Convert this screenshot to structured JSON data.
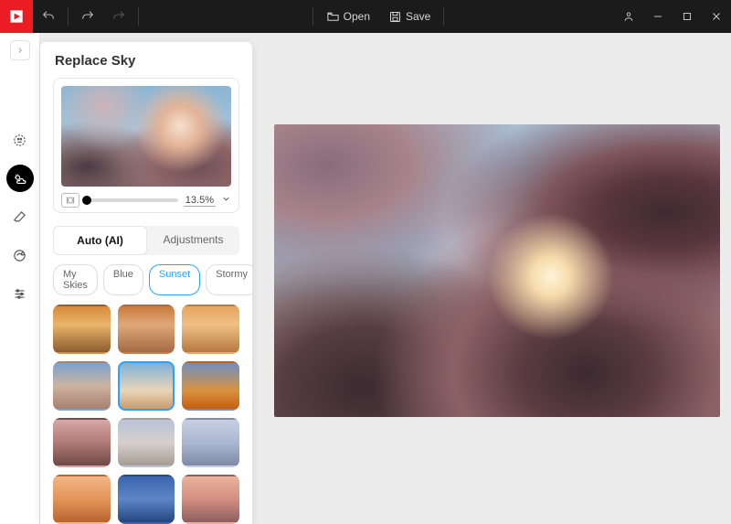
{
  "topbar": {
    "open_label": "Open",
    "save_label": "Save"
  },
  "panel": {
    "title": "Replace Sky",
    "zoom_value": "13.5%"
  },
  "tabs": {
    "auto": "Auto (AI)",
    "adjustments": "Adjustments"
  },
  "chips": {
    "my_skies": "My Skies",
    "blue": "Blue",
    "sunset": "Sunset",
    "stormy": "Stormy"
  }
}
